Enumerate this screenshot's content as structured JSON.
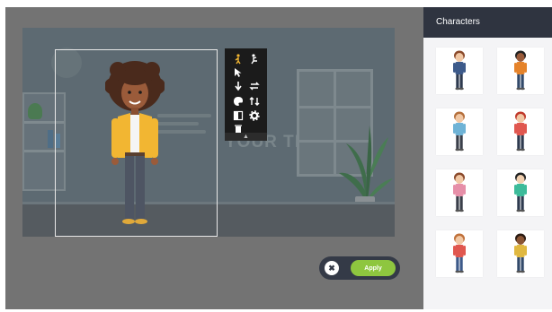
{
  "scene": {
    "background_text": "YOUR TEXT HE"
  },
  "toolbar": {
    "buttons": [
      "walk-icon",
      "pose-icon",
      "pointer-icon",
      "move-down-icon",
      "swap-icon",
      "color-icon",
      "flip-icon",
      "contrast-icon",
      "settings-icon",
      "delete-icon"
    ],
    "collapse_glyph": "▲"
  },
  "actions": {
    "cancel_glyph": "✖",
    "apply_label": "Apply"
  },
  "panel": {
    "title": "Characters",
    "items": [
      {
        "name": "character-1",
        "hair": "#8b4a2b",
        "skin": "#f1c8a5",
        "top": "#3d5a8a",
        "legs": "#2e3a4f"
      },
      {
        "name": "character-2",
        "hair": "#222222",
        "skin": "#9a5b3a",
        "top": "#e5832a",
        "legs": "#324a6a"
      },
      {
        "name": "character-3",
        "hair": "#b56f3c",
        "skin": "#f1c8a5",
        "top": "#6fb3d6",
        "legs": "#3a3f4a"
      },
      {
        "name": "character-4",
        "hair": "#c0392b",
        "skin": "#f1c8a5",
        "top": "#e0574f",
        "legs": "#2e3a4f"
      },
      {
        "name": "character-5",
        "hair": "#8b4a2b",
        "skin": "#f1c8a5",
        "top": "#e68fa8",
        "legs": "#3a3f4a"
      },
      {
        "name": "character-6",
        "hair": "#222222",
        "skin": "#f1d0b0",
        "top": "#3dbb9a",
        "legs": "#2e3a4f"
      },
      {
        "name": "character-7",
        "hair": "#c0713a",
        "skin": "#f1c8a5",
        "top": "#e0574f",
        "legs": "#3d5a8a"
      },
      {
        "name": "character-8",
        "hair": "#2a1a12",
        "skin": "#8a5535",
        "top": "#e0b840",
        "legs": "#324a6a"
      }
    ]
  },
  "colors": {
    "accent_green": "#8ec63f",
    "panel_header": "#2f3440",
    "character_jacket": "#f2b632"
  }
}
